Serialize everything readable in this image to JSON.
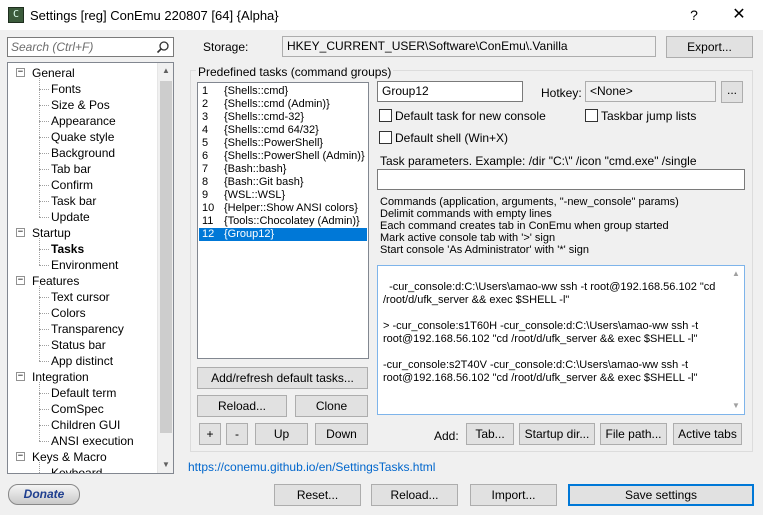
{
  "window": {
    "title": "Settings [reg] ConEmu 220807 [64] {Alpha}",
    "help": "?",
    "close": "✕",
    "icon_glyph": "C"
  },
  "search": {
    "placeholder": "Search (Ctrl+F)"
  },
  "tree": [
    {
      "label": "General",
      "level": 0,
      "expander": "−"
    },
    {
      "label": "Fonts",
      "level": 1
    },
    {
      "label": "Size & Pos",
      "level": 1
    },
    {
      "label": "Appearance",
      "level": 1
    },
    {
      "label": "Quake style",
      "level": 1
    },
    {
      "label": "Background",
      "level": 1
    },
    {
      "label": "Tab bar",
      "level": 1
    },
    {
      "label": "Confirm",
      "level": 1
    },
    {
      "label": "Task bar",
      "level": 1
    },
    {
      "label": "Update",
      "level": 1
    },
    {
      "label": "Startup",
      "level": 0,
      "expander": "−"
    },
    {
      "label": "Tasks",
      "level": 1,
      "selected": true
    },
    {
      "label": "Environment",
      "level": 1
    },
    {
      "label": "Features",
      "level": 0,
      "expander": "−"
    },
    {
      "label": "Text cursor",
      "level": 1
    },
    {
      "label": "Colors",
      "level": 1
    },
    {
      "label": "Transparency",
      "level": 1
    },
    {
      "label": "Status bar",
      "level": 1
    },
    {
      "label": "App distinct",
      "level": 1
    },
    {
      "label": "Integration",
      "level": 0,
      "expander": "−"
    },
    {
      "label": "Default term",
      "level": 1
    },
    {
      "label": "ComSpec",
      "level": 1
    },
    {
      "label": "Children GUI",
      "level": 1
    },
    {
      "label": "ANSI execution",
      "level": 1
    },
    {
      "label": "Keys & Macro",
      "level": 0,
      "expander": "−"
    },
    {
      "label": "Keyboard",
      "level": 1
    }
  ],
  "storage": {
    "label": "Storage:",
    "value": "HKEY_CURRENT_USER\\Software\\ConEmu\\.Vanilla",
    "export_label": "Export..."
  },
  "tasks": {
    "group_label": "Predefined tasks (command groups)",
    "items": [
      {
        "num": "1",
        "name": "{Shells::cmd}"
      },
      {
        "num": "2",
        "name": "{Shells::cmd (Admin)}"
      },
      {
        "num": "3",
        "name": "{Shells::cmd-32}"
      },
      {
        "num": "4",
        "name": "{Shells::cmd 64/32}"
      },
      {
        "num": "5",
        "name": "{Shells::PowerShell}"
      },
      {
        "num": "6",
        "name": "{Shells::PowerShell (Admin)}"
      },
      {
        "num": "7",
        "name": "{Bash::bash}"
      },
      {
        "num": "8",
        "name": "{Bash::Git bash}"
      },
      {
        "num": "9",
        "name": "{WSL::WSL}"
      },
      {
        "num": "10",
        "name": "{Helper::Show ANSI colors}"
      },
      {
        "num": "11",
        "name": "{Tools::Chocolatey (Admin)}"
      },
      {
        "num": "12",
        "name": "{Group12}",
        "selected": true
      }
    ],
    "add_refresh_label": "Add/refresh default tasks...",
    "reload_label": "Reload...",
    "clone_label": "Clone",
    "plus_label": "+",
    "minus_label": "-",
    "up_label": "Up",
    "down_label": "Down"
  },
  "editor": {
    "task_name": "Group12",
    "hotkey_label": "Hotkey:",
    "hotkey_value": "<None>",
    "hotkey_more": "...",
    "default_task_label": "Default task for new console",
    "default_task_checked": false,
    "jumplist_label": "Taskbar jump lists",
    "jumplist_checked": false,
    "default_shell_label": "Default shell (Win+X)",
    "default_shell_checked": false,
    "params_label": "Task parameters. Example: /dir \"C:\\\" /icon \"cmd.exe\" /single",
    "params_value": "",
    "desc_lines": [
      "Commands (application, arguments, \"-new_console\" params)",
      "Delimit commands with empty lines",
      "Each command creates tab in ConEmu when group started",
      "Mark active console tab with '>' sign",
      "Start console 'As Administrator' with '*' sign"
    ],
    "commands": "-cur_console:d:C:\\Users\\amao-ww ssh -t root@192.168.56.102 \"cd /root/d/ufk_server && exec $SHELL -l\"\n\n> -cur_console:s1T60H -cur_console:d:C:\\Users\\amao-ww ssh -t root@192.168.56.102 \"cd /root/d/ufk_server && exec $SHELL -l\"\n\n-cur_console:s2T40V -cur_console:d:C:\\Users\\amao-ww ssh -t root@192.168.56.102 \"cd /root/d/ufk_server && exec $SHELL -l\"",
    "add_label": "Add:",
    "tab_label": "Tab...",
    "startup_dir_label": "Startup dir...",
    "file_path_label": "File path...",
    "active_tabs_label": "Active tabs"
  },
  "footer": {
    "link": "https://conemu.github.io/en/SettingsTasks.html",
    "donate": "Donate",
    "reset": "Reset...",
    "reload": "Reload...",
    "import": "Import...",
    "save": "Save settings"
  },
  "colors": {
    "selection": "#0078d7",
    "link": "#0066cc",
    "background": "#f0f0f0"
  }
}
